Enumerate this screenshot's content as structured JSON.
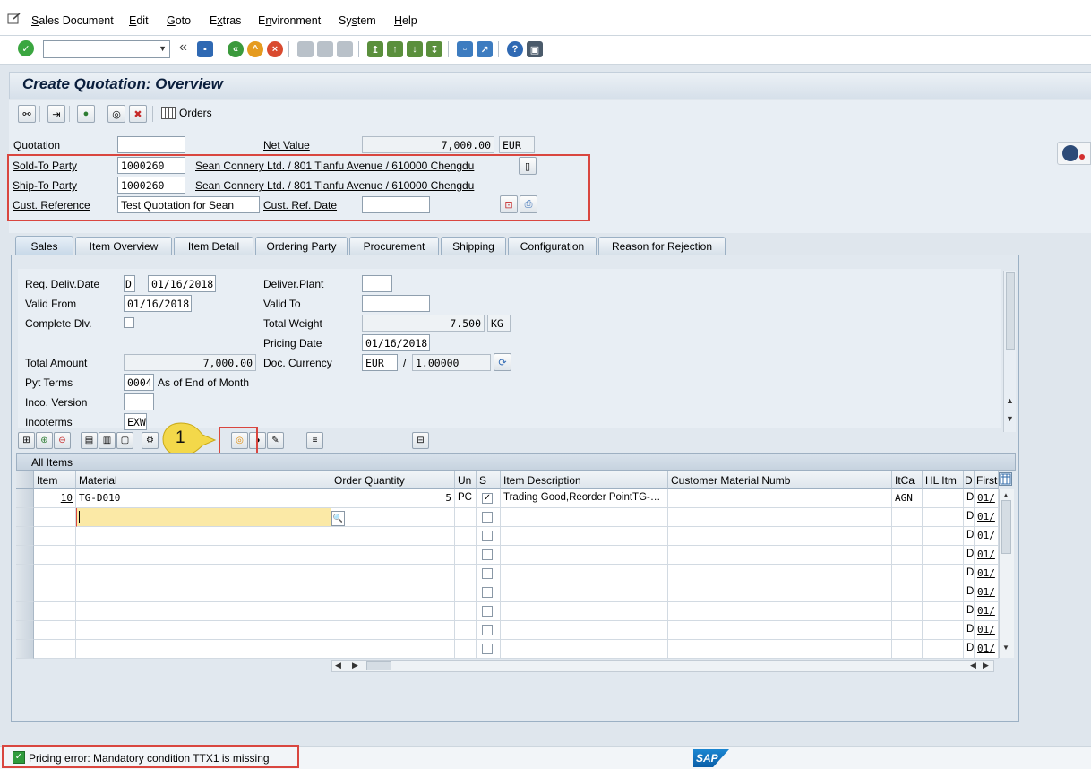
{
  "menu": {
    "items": [
      {
        "label": "Sales Document",
        "mn": "S",
        "rest": "ales Document"
      },
      {
        "label": "Edit",
        "mn": "E",
        "rest": "dit"
      },
      {
        "label": "Goto",
        "mn": "G",
        "rest": "oto"
      },
      {
        "label": "Extras",
        "mn": "",
        "pre": "E",
        "ul": "x",
        "rest": "tras"
      },
      {
        "label": "Environment",
        "mn": "",
        "pre": "E",
        "ul": "n",
        "rest": "vironment"
      },
      {
        "label": "System",
        "mn": "",
        "pre": "Sy",
        "ul": "s",
        "rest": "tem"
      },
      {
        "label": "Help",
        "mn": "H",
        "rest": "elp"
      }
    ]
  },
  "toolbar": {
    "command_value": "",
    "orders_label": "Orders"
  },
  "title": "Create Quotation: Overview",
  "header": {
    "quotation_label": "Quotation",
    "quotation_value": "",
    "net_value_label": "Net Value",
    "net_value": "7,000.00",
    "net_currency": "EUR",
    "sold_to_label": "Sold-To Party",
    "sold_to_value": "1000260",
    "sold_to_text": "Sean Connery Ltd. / 801 Tianfu Avenue / 610000 Chengdu",
    "ship_to_label": "Ship-To Party",
    "ship_to_value": "1000260",
    "ship_to_text": "Sean Connery Ltd. / 801 Tianfu Avenue / 610000 Chengdu",
    "cust_ref_label": "Cust. Reference",
    "cust_ref_value": "Test Quotation  for Sean",
    "cust_ref_date_label": "Cust. Ref. Date",
    "cust_ref_date_value": ""
  },
  "tabs": [
    {
      "label": "Sales",
      "active": true
    },
    {
      "label": "Item Overview"
    },
    {
      "label": "Item Detail"
    },
    {
      "label": "Ordering Party"
    },
    {
      "label": "Procurement"
    },
    {
      "label": "Shipping"
    },
    {
      "label": "Configuration"
    },
    {
      "label": "Reason for Rejection"
    }
  ],
  "sales": {
    "req_deliv_label": "Req. Deliv.Date",
    "req_deliv_type": "D",
    "req_deliv_date": "01/16/2018",
    "deliver_plant_label": "Deliver.Plant",
    "deliver_plant_value": "",
    "valid_from_label": "Valid From",
    "valid_from_value": "01/16/2018",
    "valid_to_label": "Valid To",
    "valid_to_value": "",
    "complete_dlv_label": "Complete Dlv.",
    "total_weight_label": "Total Weight",
    "total_weight_value": "7.500",
    "total_weight_unit": "KG",
    "pricing_date_label": "Pricing Date",
    "pricing_date_value": "01/16/2018",
    "total_amount_label": "Total Amount",
    "total_amount_value": "7,000.00",
    "doc_currency_label": "Doc. Currency",
    "doc_currency_value": "EUR",
    "doc_currency_sep": "/",
    "doc_rate_value": "1.00000",
    "pyt_terms_label": "Pyt Terms",
    "pyt_terms_value": "0004",
    "pyt_terms_text": "As of End of Month",
    "inco_version_label": "Inco. Version",
    "inco_version_value": "",
    "incoterms_label": "Incoterms",
    "incoterms_value": "EXW"
  },
  "callout": "1",
  "table": {
    "title": "All Items",
    "columns": [
      "Item",
      "Material",
      "Order Quantity",
      "Un",
      "S",
      "Item Description",
      "Customer Material Numb",
      "ItCa",
      "HL Itm",
      "D",
      "First"
    ],
    "rows": [
      {
        "item": "10",
        "material": "TG-D010",
        "qty": "5",
        "unit": "PC",
        "s_checked": true,
        "desc": "Trading Good,Reorder PointTG-…",
        "cust_mat": "",
        "itca": "AGN",
        "hl": "",
        "d": "D",
        "first": "01/"
      },
      {
        "item": "",
        "material": "",
        "qty": "",
        "unit": "",
        "s_checked": false,
        "desc": "",
        "cust_mat": "",
        "itca": "",
        "hl": "",
        "d": "D",
        "first": "01/"
      },
      {
        "item": "",
        "material": "",
        "qty": "",
        "unit": "",
        "s_checked": false,
        "desc": "",
        "cust_mat": "",
        "itca": "",
        "hl": "",
        "d": "D",
        "first": "01/"
      },
      {
        "item": "",
        "material": "",
        "qty": "",
        "unit": "",
        "s_checked": false,
        "desc": "",
        "cust_mat": "",
        "itca": "",
        "hl": "",
        "d": "D",
        "first": "01/"
      },
      {
        "item": "",
        "material": "",
        "qty": "",
        "unit": "",
        "s_checked": false,
        "desc": "",
        "cust_mat": "",
        "itca": "",
        "hl": "",
        "d": "D",
        "first": "01/"
      },
      {
        "item": "",
        "material": "",
        "qty": "",
        "unit": "",
        "s_checked": false,
        "desc": "",
        "cust_mat": "",
        "itca": "",
        "hl": "",
        "d": "D",
        "first": "01/"
      },
      {
        "item": "",
        "material": "",
        "qty": "",
        "unit": "",
        "s_checked": false,
        "desc": "",
        "cust_mat": "",
        "itca": "",
        "hl": "",
        "d": "D",
        "first": "01/"
      },
      {
        "item": "",
        "material": "",
        "qty": "",
        "unit": "",
        "s_checked": false,
        "desc": "",
        "cust_mat": "",
        "itca": "",
        "hl": "",
        "d": "D",
        "first": "01/"
      },
      {
        "item": "",
        "material": "",
        "qty": "",
        "unit": "",
        "s_checked": false,
        "desc": "",
        "cust_mat": "",
        "itca": "",
        "hl": "",
        "d": "D",
        "first": "01/"
      }
    ]
  },
  "status": {
    "message": "Pricing error: Mandatory condition TTX1 is missing"
  },
  "brand": {
    "logo_text": "SAP",
    "accent_red": "#d9463f",
    "title_color": "#0a1e3c"
  },
  "icons": {
    "status": "check-icon",
    "sap": "sap-logo"
  }
}
